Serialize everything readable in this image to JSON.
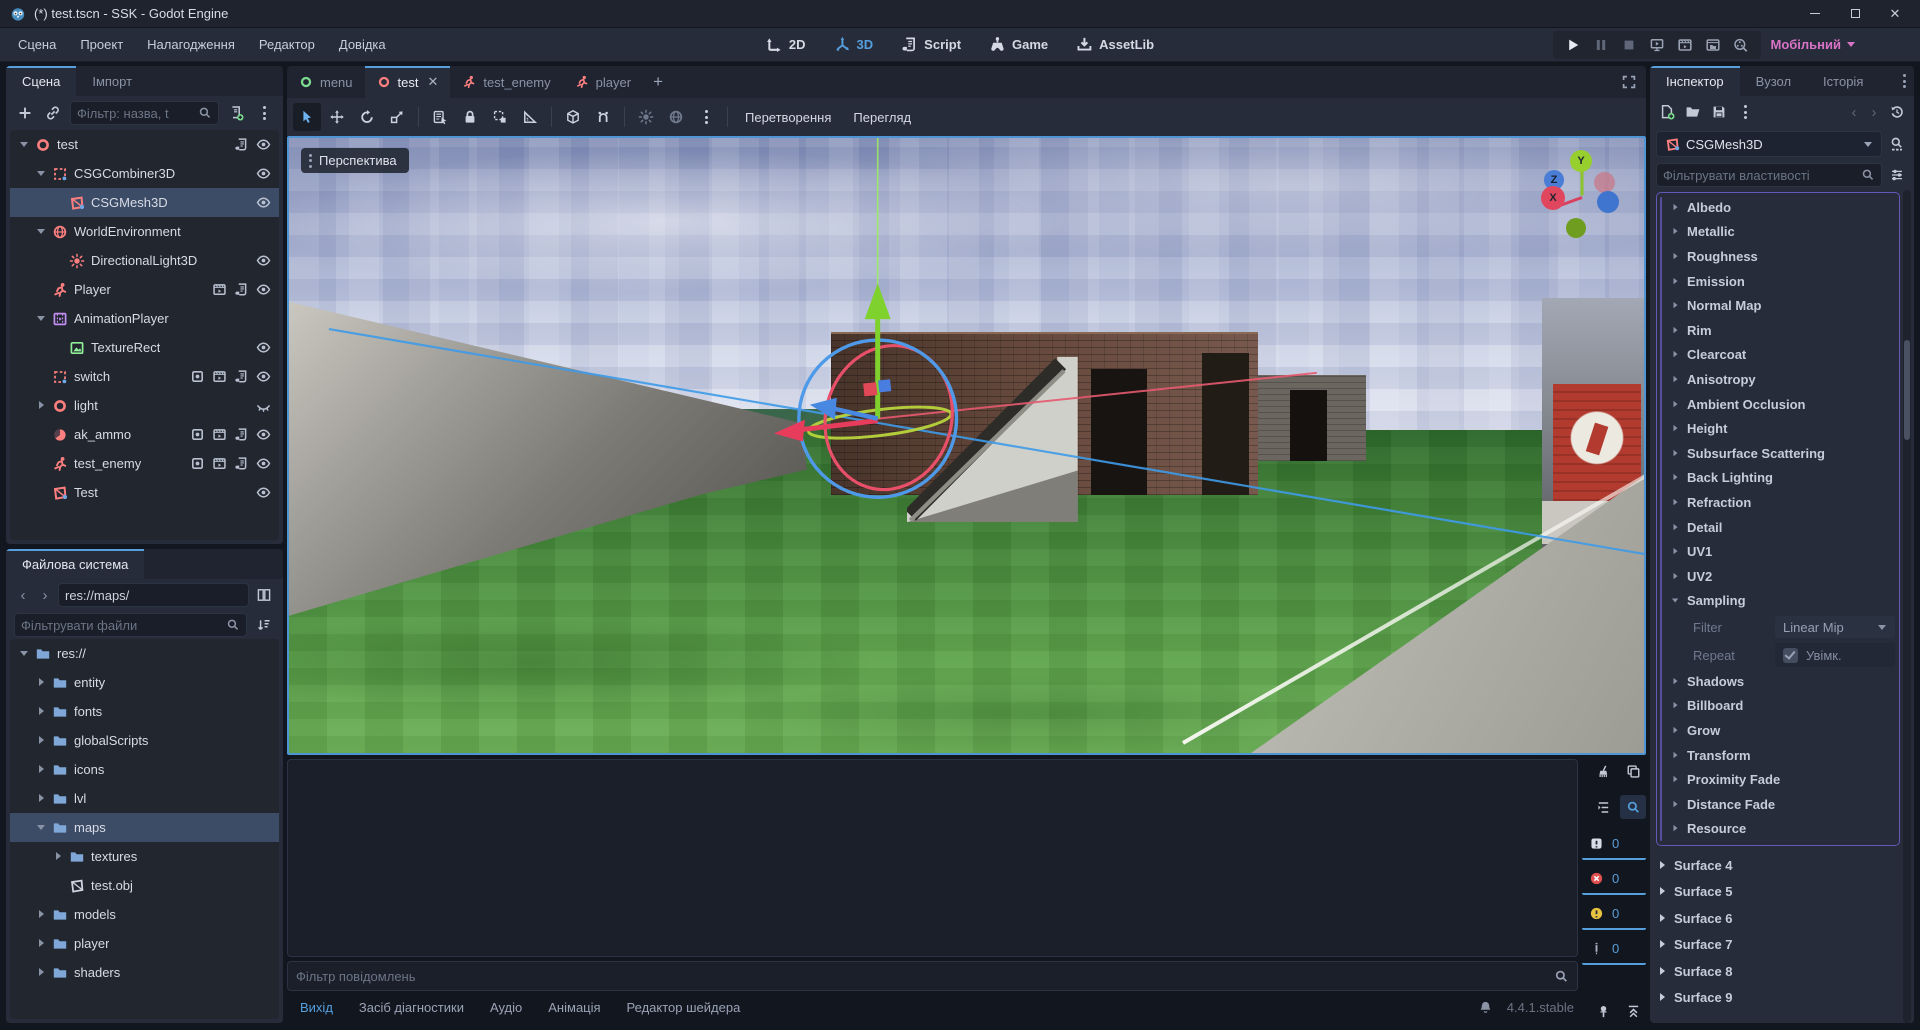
{
  "window": {
    "title": "(*) test.tscn - SSK - Godot Engine"
  },
  "menubar": {
    "items": [
      "Сцена",
      "Проект",
      "Налагодження",
      "Редактор",
      "Довідка"
    ],
    "workspaces": [
      {
        "label": "2D",
        "icon": "2d",
        "cls": ""
      },
      {
        "label": "3D",
        "icon": "3d",
        "cls": "active"
      },
      {
        "label": "Script",
        "icon": "script",
        "cls": ""
      },
      {
        "label": "Game",
        "icon": "game",
        "cls": ""
      },
      {
        "label": "AssetLib",
        "icon": "assetlib",
        "cls": ""
      }
    ],
    "profile": "Мобільний"
  },
  "scene_dock": {
    "tabs": [
      {
        "label": "Сцена",
        "cls": "active"
      },
      {
        "label": "Імпорт",
        "cls": ""
      }
    ],
    "filter_placeholder": "Фільтр: назва, t",
    "tree": [
      {
        "label": "test",
        "icon": "circle",
        "color": "#fc7f7f",
        "depth": 0,
        "exp": "down",
        "cls": "",
        "badges": [
          "script",
          "eye"
        ]
      },
      {
        "label": "CSGCombiner3D",
        "icon": "dashedrect",
        "color": "#fc7f7f",
        "depth": 1,
        "exp": "down",
        "cls": "",
        "badges": [
          "eye"
        ]
      },
      {
        "label": "CSGMesh3D",
        "icon": "csgmesh",
        "color": "#fc7f7f",
        "depth": 2,
        "exp": "",
        "cls": "selected",
        "badges": [
          "eye"
        ]
      },
      {
        "label": "WorldEnvironment",
        "icon": "globe",
        "color": "#fc7f7f",
        "depth": 1,
        "exp": "down",
        "cls": "",
        "badges": []
      },
      {
        "label": "DirectionalLight3D",
        "icon": "sun",
        "color": "#fc7f7f",
        "depth": 2,
        "exp": "",
        "cls": "",
        "badges": [
          "eye"
        ]
      },
      {
        "label": "Player",
        "icon": "runner",
        "color": "#fc7f7f",
        "depth": 1,
        "exp": "",
        "cls": "",
        "badges": [
          "clapper",
          "script",
          "eye"
        ]
      },
      {
        "label": "AnimationPlayer",
        "icon": "film",
        "color": "#c38ef1",
        "depth": 1,
        "exp": "down",
        "cls": "",
        "badges": []
      },
      {
        "label": "TextureRect",
        "icon": "image",
        "color": "#8eef97",
        "depth": 2,
        "exp": "",
        "cls": "",
        "badges": [
          "eye"
        ]
      },
      {
        "label": "switch",
        "icon": "dashedrect",
        "color": "#fc7f7f",
        "depth": 1,
        "exp": "",
        "cls": "",
        "badges": [
          "slot",
          "clapper",
          "script",
          "eye"
        ]
      },
      {
        "label": "light",
        "icon": "circle",
        "color": "#fc7f7f",
        "depth": 1,
        "exp": "right",
        "cls": "",
        "badges": [
          "eyeclosed"
        ]
      },
      {
        "label": "ak_ammo",
        "icon": "sphere",
        "color": "#fc7f7f",
        "depth": 1,
        "exp": "",
        "cls": "",
        "badges": [
          "slot",
          "clapper",
          "script",
          "eye"
        ]
      },
      {
        "label": "test_enemy",
        "icon": "runner",
        "color": "#fc7f7f",
        "depth": 1,
        "exp": "",
        "cls": "",
        "badges": [
          "slot",
          "clapper",
          "script",
          "eye"
        ]
      },
      {
        "label": "Test",
        "icon": "csgmesh",
        "color": "#fc7f7f",
        "depth": 1,
        "exp": "",
        "cls": "",
        "badges": [
          "eye"
        ]
      }
    ]
  },
  "filesystem_dock": {
    "tab": "Файлова система",
    "path": "res://maps/",
    "filter_placeholder": "Фільтрувати файли",
    "tree": [
      {
        "label": "res://",
        "icon": "folder",
        "color": "#7fa7d8",
        "depth": 0,
        "exp": "down",
        "cls": ""
      },
      {
        "label": "entity",
        "icon": "folder",
        "color": "#7fa7d8",
        "depth": 1,
        "exp": "right",
        "cls": ""
      },
      {
        "label": "fonts",
        "icon": "folder",
        "color": "#7fa7d8",
        "depth": 1,
        "exp": "right",
        "cls": ""
      },
      {
        "label": "globalScripts",
        "icon": "folder",
        "color": "#7fa7d8",
        "depth": 1,
        "exp": "right",
        "cls": ""
      },
      {
        "label": "icons",
        "icon": "folder",
        "color": "#7fa7d8",
        "depth": 1,
        "exp": "right",
        "cls": ""
      },
      {
        "label": "lvl",
        "icon": "folder",
        "color": "#7fa7d8",
        "depth": 1,
        "exp": "right",
        "cls": ""
      },
      {
        "label": "maps",
        "icon": "folder",
        "color": "#7fa7d8",
        "depth": 1,
        "exp": "down",
        "cls": "selected"
      },
      {
        "label": "textures",
        "icon": "folder",
        "color": "#7fa7d8",
        "depth": 2,
        "exp": "right",
        "cls": ""
      },
      {
        "label": "test.obj",
        "icon": "meshfile",
        "color": "#cdd3df",
        "depth": 2,
        "exp": "",
        "cls": ""
      },
      {
        "label": "models",
        "icon": "folder",
        "color": "#7fa7d8",
        "depth": 1,
        "exp": "right",
        "cls": ""
      },
      {
        "label": "player",
        "icon": "folder",
        "color": "#7fa7d8",
        "depth": 1,
        "exp": "right",
        "cls": ""
      },
      {
        "label": "shaders",
        "icon": "folder",
        "color": "#7fa7d8",
        "depth": 1,
        "exp": "right",
        "cls": ""
      }
    ]
  },
  "editor": {
    "scene_tabs": [
      {
        "label": "menu",
        "icon": "circle",
        "color": "#7bdc8e",
        "cls": "",
        "closable": false
      },
      {
        "label": "test",
        "icon": "circle",
        "color": "#fc7f7f",
        "cls": "active",
        "closable": true
      },
      {
        "label": "test_enemy",
        "icon": "runner",
        "color": "#fc7f7f",
        "cls": "",
        "closable": false
      },
      {
        "label": "player",
        "icon": "runner",
        "color": "#fc7f7f",
        "cls": "",
        "closable": false
      }
    ],
    "close_glyph": "✕",
    "toolbar_menus": {
      "transform": "Перетворення",
      "view": "Перегляд"
    },
    "viewport_label": "Перспектива",
    "axis_gizmo": {
      "x": "X",
      "y": "Y",
      "z": "Z"
    }
  },
  "bottom_panel": {
    "filter_placeholder": "Фільтр повідомлень",
    "tabs": [
      {
        "label": "Вихід",
        "cls": "active"
      },
      {
        "label": "Засіб діагностики",
        "cls": ""
      },
      {
        "label": "Аудіо",
        "cls": ""
      },
      {
        "label": "Анімація",
        "cls": ""
      },
      {
        "label": "Редактор шейдера",
        "cls": ""
      }
    ],
    "counts": {
      "messages": "0",
      "errors": "0",
      "warnings": "0",
      "edits": "0"
    },
    "version": "4.4.1.stable",
    "status_colors": {
      "error": "#e0504f",
      "warning": "#e8c340"
    }
  },
  "inspector": {
    "tabs": [
      {
        "label": "Інспектор",
        "cls": "active"
      },
      {
        "label": "Вузол",
        "cls": ""
      },
      {
        "label": "Історія",
        "cls": ""
      }
    ],
    "node_name": "CSGMesh3D",
    "filter_placeholder": "Фільтрувати властивості",
    "material_sections": [
      "Albedo",
      "Metallic",
      "Roughness",
      "Emission",
      "Normal Map",
      "Rim",
      "Clearcoat",
      "Anisotropy",
      "Ambient Occlusion",
      "Height",
      "Subsurface Scattering",
      "Back Lighting",
      "Refraction",
      "Detail",
      "UV1",
      "UV2"
    ],
    "sampling": {
      "label": "Sampling",
      "filter_label": "Filter",
      "filter_value": "Linear Mip",
      "repeat_label": "Repeat",
      "repeat_value": "Увімк."
    },
    "post_sections": [
      "Shadows",
      "Billboard",
      "Grow",
      "Transform",
      "Proximity Fade",
      "Distance Fade",
      "Resource"
    ],
    "surfaces": [
      "Surface 4",
      "Surface 5",
      "Surface 6",
      "Surface 7",
      "Surface 8",
      "Surface 9"
    ],
    "accent_purple": "#6259b8"
  }
}
